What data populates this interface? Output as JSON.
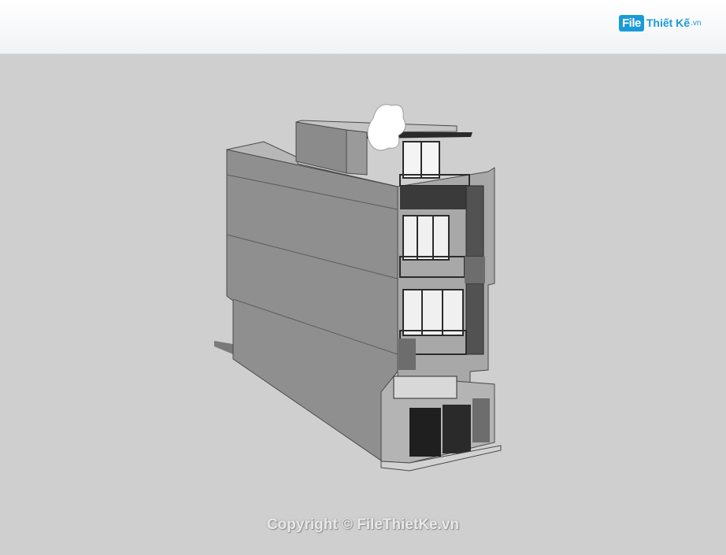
{
  "header": {
    "logo": {
      "badge": "File",
      "text": "Thiết Kế",
      "tld": ".vn"
    }
  },
  "viewport": {
    "background_color": "#cfcfcf",
    "model": "3-storey townhouse 3D model"
  },
  "watermark": {
    "text": "Copyright © FileThietKe.vn"
  },
  "colors": {
    "brand": "#1a9bd7",
    "wall": "#8e8e8e",
    "facade": "#a9a9a9"
  }
}
